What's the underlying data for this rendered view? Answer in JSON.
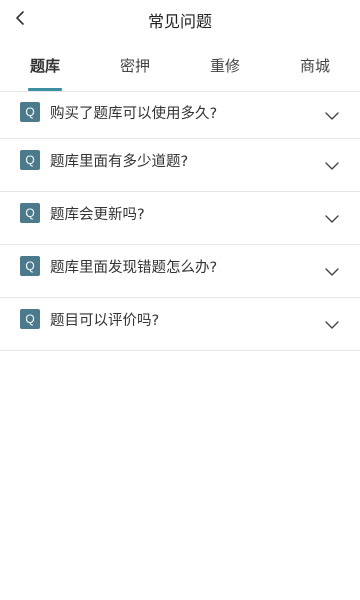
{
  "header": {
    "title": "常见问题"
  },
  "tabs": [
    {
      "label": "题库",
      "active": true
    },
    {
      "label": "密押",
      "active": false
    },
    {
      "label": "重修",
      "active": false
    },
    {
      "label": "商城",
      "active": false
    }
  ],
  "faq": {
    "badge": "Q",
    "items": [
      {
        "question": "购买了题库可以使用多久?"
      },
      {
        "question": "题库里面有多少道题?"
      },
      {
        "question": "题库会更新吗?"
      },
      {
        "question": "题库里面发现错题怎么办?"
      },
      {
        "question": "题目可以评价吗?"
      }
    ]
  },
  "colors": {
    "accent": "#3b8fa0",
    "badge_bg": "#4a7a8c",
    "divider": "#e6e6e6"
  },
  "icons": {
    "back": "chevron-left-icon",
    "expand": "chevron-down-icon"
  }
}
